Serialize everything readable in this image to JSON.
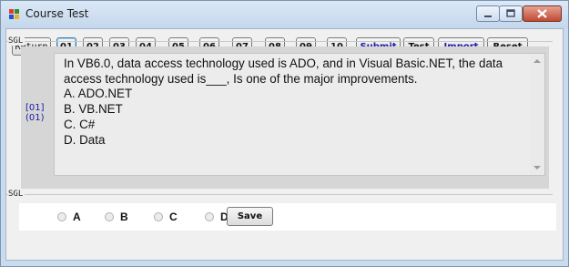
{
  "window": {
    "title": "Course Test",
    "icon": "app-window-icon",
    "controls": [
      "minimize-icon",
      "maximize-icon",
      "close-icon"
    ]
  },
  "toolbar": {
    "return_label": "Return",
    "question_buttons": [
      "01",
      "02",
      "03",
      "04",
      "05",
      "06",
      "07",
      "08",
      "09",
      "10"
    ],
    "active_question": "01",
    "submit_label": "Submit",
    "test_label": "Test",
    "import_label": "Import",
    "reset_label": "Reset",
    "accent_color": "#1a1aa6"
  },
  "question": {
    "section_label": "SGL",
    "number_line1": "[01]",
    "number_line2": "(01)",
    "text": "In VB6.0, data access technology used is ADO, and in Visual Basic.NET, the data access technology used is___, Is one of the major improvements.",
    "options": [
      "A. ADO.NET",
      "B. VB.NET",
      "C. C#",
      "D. Data"
    ]
  },
  "answer": {
    "section_label": "SGL",
    "choices": [
      "A",
      "B",
      "C",
      "D"
    ],
    "selected": null,
    "save_label": "Save"
  }
}
